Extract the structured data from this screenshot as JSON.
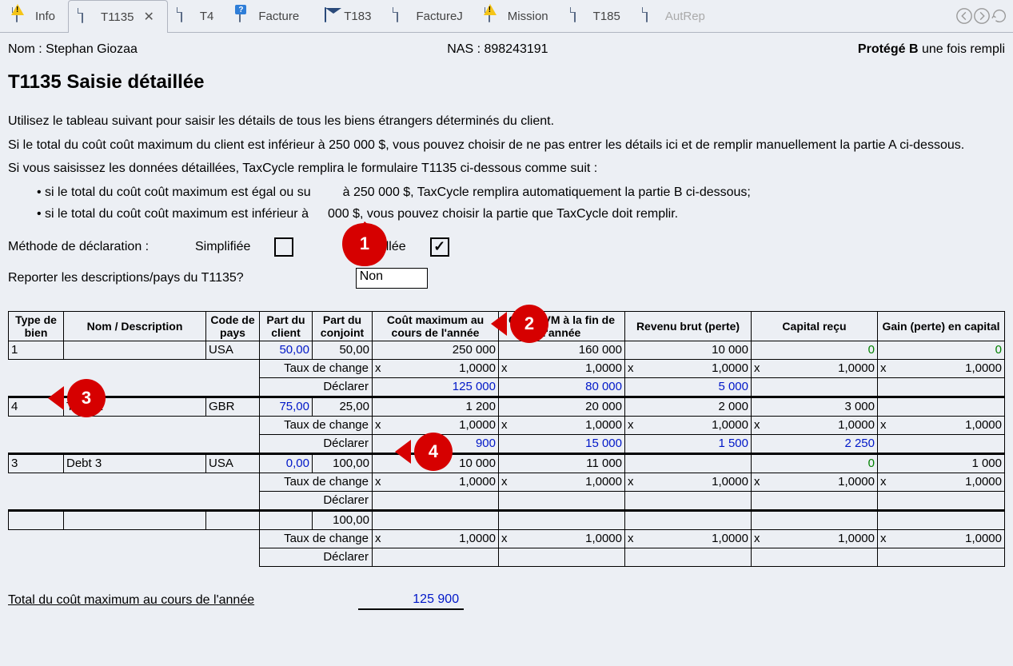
{
  "tabs": [
    {
      "label": "Info",
      "icon": "warn"
    },
    {
      "label": "T1135",
      "icon": "doc",
      "active": true
    },
    {
      "label": "T4",
      "icon": "doc"
    },
    {
      "label": "Facture",
      "icon": "q"
    },
    {
      "label": "T183",
      "icon": "env"
    },
    {
      "label": "FactureJ",
      "icon": "doc"
    },
    {
      "label": "Mission",
      "icon": "warn"
    },
    {
      "label": "T185",
      "icon": "doc"
    },
    {
      "label": "AutRep",
      "icon": "doc"
    }
  ],
  "header": {
    "name_label": "Nom : Stephan Giozaa",
    "nas_label": "NAS : 898243191",
    "prot_bold": "Protégé B",
    "prot_rest": " une fois rempli"
  },
  "title": "T1135 Saisie détaillée",
  "para1": "Utilisez le tableau suivant pour saisir les détails de tous les biens étrangers déterminés du client.",
  "para2": "Si le total du coût coût maximum du client est inférieur à 250 000 $, vous pouvez choisir de ne pas entrer les détails ici et de remplir manuellement la partie A ci-dessous.",
  "para3": "Si vous saisissez les données détaillées, TaxCycle remplira le formulaire T1135 ci-dessous comme suit :",
  "bullet1": "• si le total du coût coût maximum est égal ou supérieur à 250 000 $, TaxCycle remplira automatiquement la partie B ci-dessous;",
  "bullet2": "• si le total du coût coût maximum est inférieur à 250 000 $, vous pouvez choisir la partie que TaxCycle doit remplir.",
  "bullet1_vis": "• si le total du coût coût maximum est égal ou su",
  "bullet1_vis2": "à 250 000 $, TaxCycle remplira automatiquement la partie B ci-dessous;",
  "bullet2_vis": "• si le total du coût coût maximum est inférieur à",
  "bullet2_vis2": "000 $, vous pouvez choisir la partie que TaxCycle doit remplir.",
  "method": {
    "label": "Méthode de déclaration :",
    "opt1": "Simplifiée",
    "opt2": "Détaillée",
    "checked1": false,
    "checked2": true
  },
  "report": {
    "label": "Reporter les descriptions/pays du T1135?",
    "value": "Non"
  },
  "callouts": {
    "c1": "1",
    "c2": "2",
    "c3": "3",
    "c4": "4"
  },
  "columns": {
    "c0": "Type de bien",
    "c1": "Nom / Description",
    "c2": "Code de pays",
    "c3": "Part du client",
    "c4": "Part du conjoint",
    "c5": "Coût maximum au cours de l'année",
    "c6": "Coût/JVM à la fin de l'année",
    "c7": "Revenu brut (perte)",
    "c8": "Capital reçu",
    "c9": "Gain (perte) en capital"
  },
  "rowlabels": {
    "taux": "Taux de change",
    "decl": "Déclarer"
  },
  "rows": [
    {
      "type": "1",
      "desc": "",
      "pays": "USA",
      "client": "50,00",
      "conjoint": "50,00",
      "cout": "250 000",
      "jvm": "160 000",
      "rev": "10 000",
      "cap": "0",
      "gain": "0",
      "txc": "1,0000",
      "txj": "1,0000",
      "txr": "1,0000",
      "txp": "1,0000",
      "txg": "1,0000",
      "dcout": "125 000",
      "djvm": "80 000",
      "drev": "5 000",
      "dcap": "",
      "dgain": ""
    },
    {
      "type": "4",
      "desc": "Trust 2",
      "pays": "GBR",
      "client": "75,00",
      "conjoint": "25,00",
      "cout": "1 200",
      "jvm": "20 000",
      "rev": "2 000",
      "cap": "3 000",
      "gain": "",
      "txc": "1,0000",
      "txj": "1,0000",
      "txr": "1,0000",
      "txp": "1,0000",
      "txg": "1,0000",
      "dcout": "900",
      "djvm": "15 000",
      "drev": "1 500",
      "dcap": "2 250",
      "dgain": ""
    },
    {
      "type": "3",
      "desc": "Debt 3",
      "pays": "USA",
      "client": "0,00",
      "conjoint": "100,00",
      "cout": "10 000",
      "jvm": "11 000",
      "rev": "",
      "cap": "0",
      "gain": "1 000",
      "txc": "1,0000",
      "txj": "1,0000",
      "txr": "1,0000",
      "txp": "1,0000",
      "txg": "1,0000",
      "dcout": "",
      "djvm": "",
      "drev": "",
      "dcap": "",
      "dgain": ""
    },
    {
      "type": "",
      "desc": "",
      "pays": "",
      "client": "",
      "conjoint": "100,00",
      "cout": "",
      "jvm": "",
      "rev": "",
      "cap": "",
      "gain": "",
      "txc": "1,0000",
      "txj": "1,0000",
      "txr": "1,0000",
      "txp": "1,0000",
      "txg": "1,0000",
      "dcout": "",
      "djvm": "",
      "drev": "",
      "dcap": "",
      "dgain": ""
    }
  ],
  "total": {
    "label": "Total du coût maximum au cours de l'année",
    "value": "125 900"
  }
}
